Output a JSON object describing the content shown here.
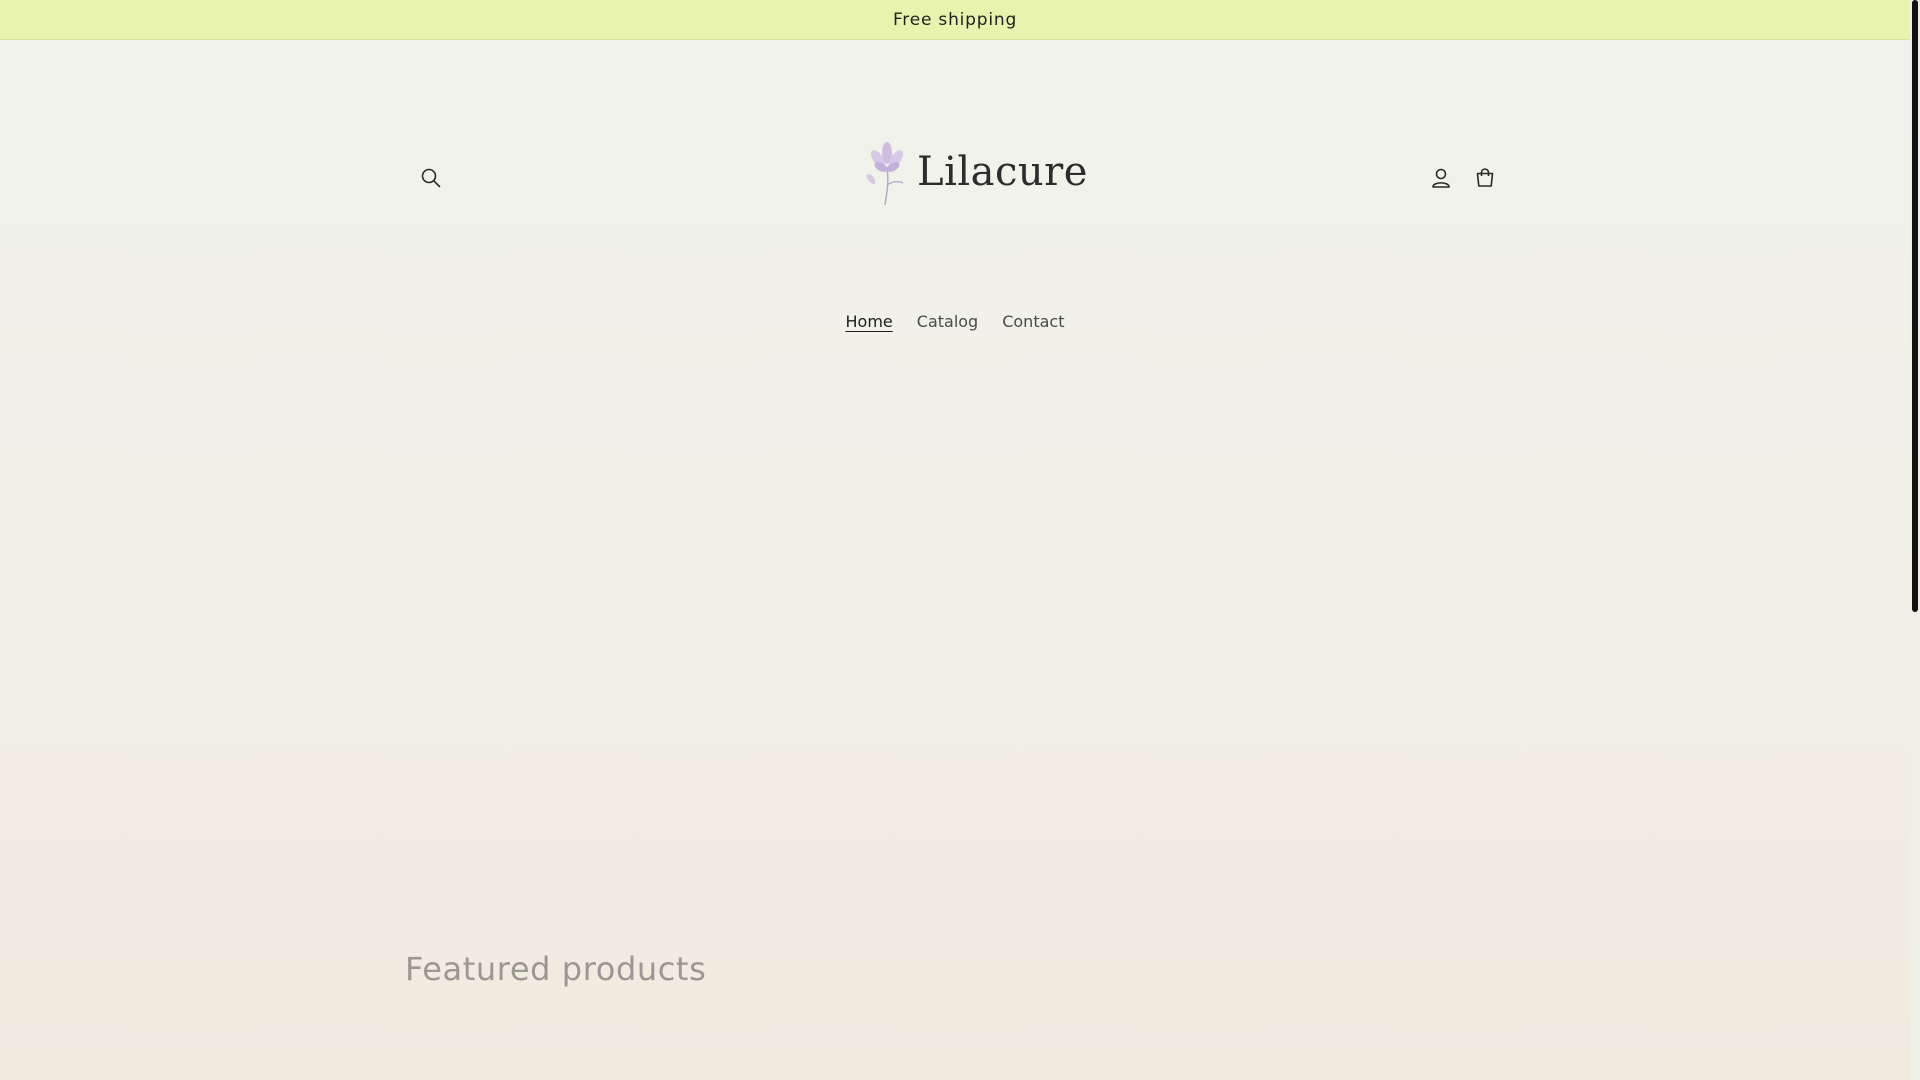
{
  "announcement": {
    "text": "Free shipping"
  },
  "header": {
    "logo_text": "Lilacure",
    "icons": {
      "search": "search-icon",
      "account": "account-icon",
      "cart": "cart-icon"
    }
  },
  "nav": {
    "items": [
      {
        "label": "Home",
        "active": true
      },
      {
        "label": "Catalog",
        "active": false
      },
      {
        "label": "Contact",
        "active": false
      }
    ]
  },
  "featured": {
    "title": "Featured products"
  },
  "colors": {
    "announcement_bg": "#e8f4ae",
    "logo_flower": "#c9b6dd",
    "text_dark": "#222222"
  }
}
